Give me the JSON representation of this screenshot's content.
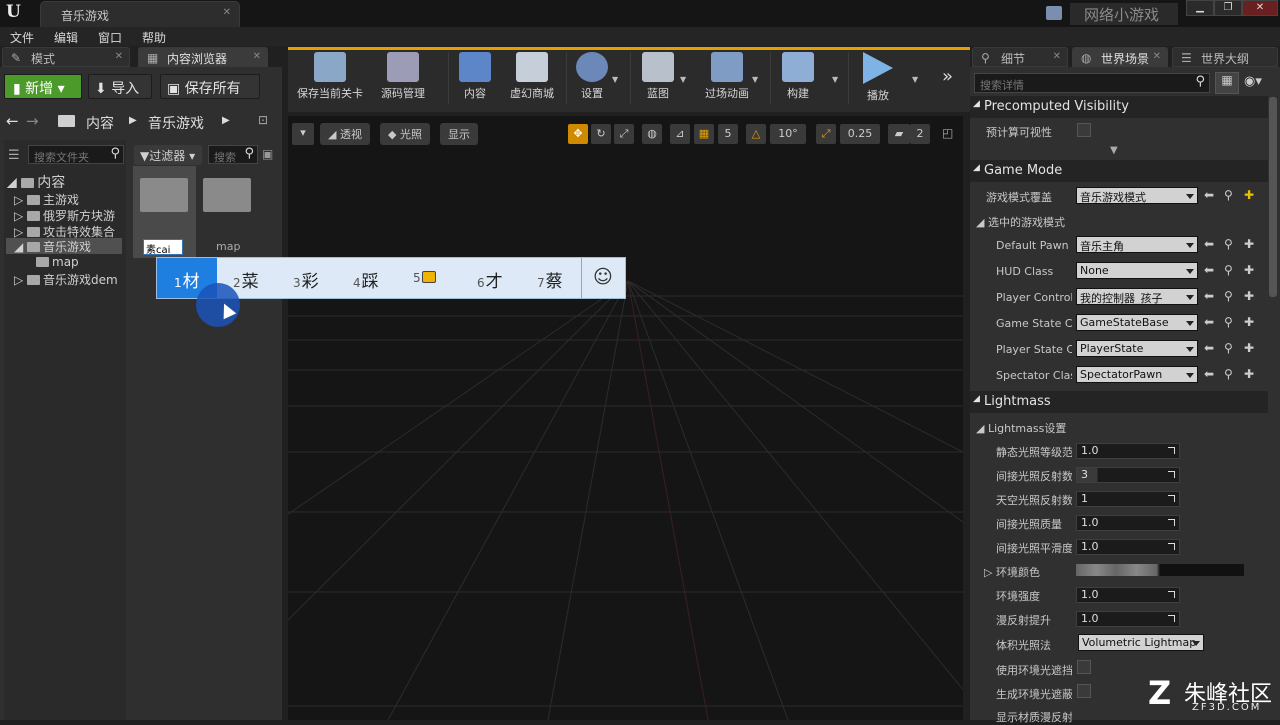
{
  "window": {
    "doc_tab": "音乐游戏",
    "project_name": "网络小游戏"
  },
  "menu": [
    "文件",
    "编辑",
    "窗口",
    "帮助"
  ],
  "panel_tabs": {
    "modes": "模式",
    "content_browser": "内容浏览器",
    "details": "细节",
    "world_settings": "世界场景",
    "world_outliner": "世界大纲"
  },
  "content_browser": {
    "new_label": "新增",
    "import_label": "导入",
    "save_all_label": "保存所有",
    "path": [
      "内容",
      "音乐游戏"
    ],
    "search_folders_placeholder": "搜索文件夹",
    "filters_label": "过滤器",
    "search_assets_placeholder": "搜索",
    "tree": [
      {
        "label": "内容",
        "level": 0
      },
      {
        "label": "主游戏",
        "level": 1
      },
      {
        "label": "俄罗斯方块游",
        "level": 1
      },
      {
        "label": "攻击特效集合",
        "level": 1
      },
      {
        "label": "音乐游戏",
        "level": 1
      },
      {
        "label": "map",
        "level": 2
      },
      {
        "label": "音乐游戏dem",
        "level": 1
      }
    ],
    "rename_text": "素cai",
    "asset_map": "map"
  },
  "ime": {
    "candidates": [
      {
        "num": "1",
        "text": "材"
      },
      {
        "num": "2",
        "text": "菜"
      },
      {
        "num": "3",
        "text": "彩"
      },
      {
        "num": "4",
        "text": "踩"
      },
      {
        "num": "5",
        "text": ""
      },
      {
        "num": "6",
        "text": "才"
      },
      {
        "num": "7",
        "text": "蔡"
      }
    ],
    "emoji": "☺"
  },
  "toolbar": [
    "保存当前关卡",
    "源码管理",
    "内容",
    "虚幻商城",
    "设置",
    "蓝图",
    "过场动画",
    "构建",
    "播放"
  ],
  "viewport": {
    "perspective": "透视",
    "lit": "光照",
    "show": "显示",
    "grid_snap": "5",
    "rot_snap": "10°",
    "scale_snap": "0.25",
    "cam_speed": "2"
  },
  "details": {
    "search_placeholder": "搜索详情",
    "precomputed": {
      "title": "Precomputed Visibility",
      "label": "预计算可视性"
    },
    "game_mode": {
      "title": "Game Mode",
      "override_label": "游戏模式覆盖",
      "override_value": "音乐游戏模式",
      "selected_label": "选中的游戏模式",
      "rows": [
        {
          "label": "Default Pawn C",
          "value": "音乐主角"
        },
        {
          "label": "HUD Class",
          "value": "None"
        },
        {
          "label": "Player Controll",
          "value": "我的控制器_孩子"
        },
        {
          "label": "Game State Cla",
          "value": "GameStateBase"
        },
        {
          "label": "Player State Cl",
          "value": "PlayerState"
        },
        {
          "label": "Spectator Clas",
          "value": "SpectatorPawn"
        }
      ]
    },
    "lightmass": {
      "title": "Lightmass",
      "settings_label": "Lightmass设置",
      "rows": [
        {
          "label": "静态光照等级范",
          "value": "1.0"
        },
        {
          "label": "间接光照反射数",
          "value": "3"
        },
        {
          "label": "天空光照反射数",
          "value": "1"
        },
        {
          "label": "间接光照质量",
          "value": "1.0"
        },
        {
          "label": "间接光照平滑度",
          "value": "1.0"
        }
      ],
      "env_color_label": "环境颜色",
      "rows2": [
        {
          "label": "环境强度",
          "value": "1.0"
        },
        {
          "label": "漫反射提升",
          "value": "1.0"
        }
      ],
      "volumetric_label": "体积光照法",
      "volumetric_value": "Volumetric Lightmap",
      "ao_label": "使用环境光遮挡",
      "gen_ao_label": "生成环境光遮蔽",
      "diffuse_label": "显示材质漫反射"
    }
  },
  "watermark": {
    "brand": "朱峰社区",
    "url": "ZF3D.COM"
  }
}
